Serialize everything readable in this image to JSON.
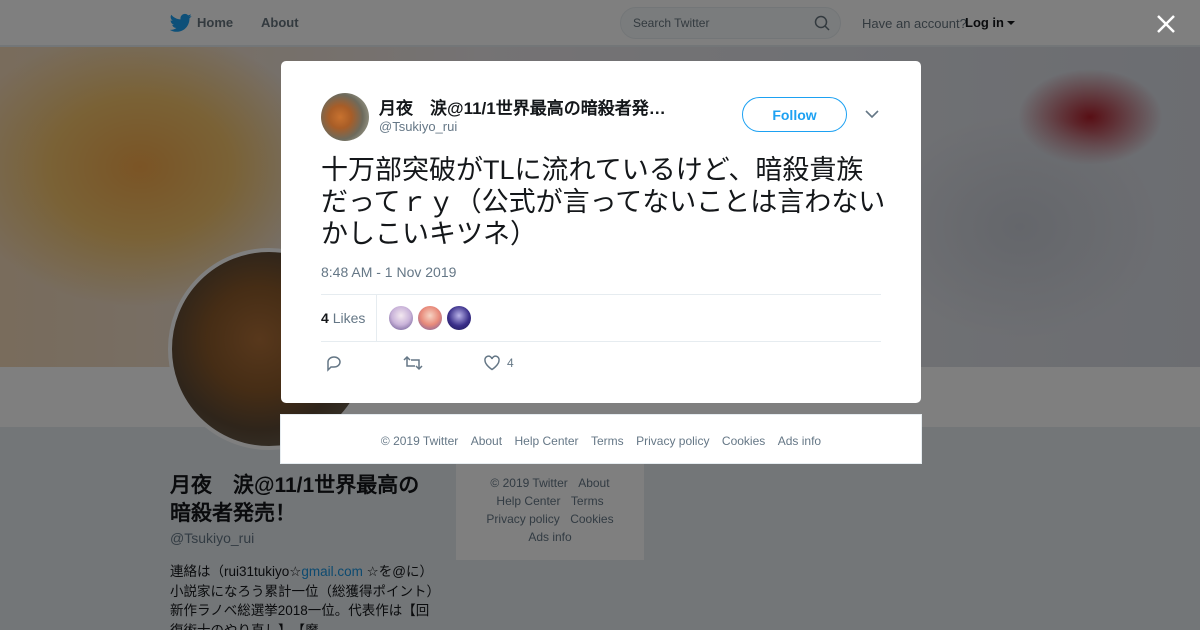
{
  "nav": {
    "home": "Home",
    "about": "About",
    "search_placeholder": "Search Twitter",
    "have_account": "Have an account?",
    "login": "Log in"
  },
  "profile": {
    "name": "月夜　涙@11/1世界最高の暗殺者発売！",
    "handle": "@Tsukiyo_rui",
    "bio_prefix": "連絡は（rui31tukiyo☆",
    "bio_link": "gmail.com",
    "bio_rest": " ☆を@に）小説家になろう累計一位（総獲得ポイント）　新作ラノベ総選挙2018一位。代表作は【回復術士のやり直し】、【魔"
  },
  "side_footer": [
    "© 2019 Twitter",
    "About",
    "Help Center",
    "Terms",
    "Privacy policy",
    "Cookies",
    "Ads info"
  ],
  "tweet": {
    "name": "月夜　涙@11/1世界最高の暗殺者発…",
    "handle": "@Tsukiyo_rui",
    "follow": "Follow",
    "text": "十万部突破がTLに流れているけど、暗殺貴族だってｒｙ（公式が言ってないことは言わないかしこいキツネ）",
    "time": "8:48 AM - 1 Nov 2019",
    "likes_count": "4",
    "likes_label": "Likes",
    "like_action_count": "4"
  },
  "modal_footer": [
    "© 2019 Twitter",
    "About",
    "Help Center",
    "Terms",
    "Privacy policy",
    "Cookies",
    "Ads info"
  ],
  "colors": {
    "accent": "#1da1f2",
    "link": "#1b95e0",
    "muted": "#657786"
  }
}
